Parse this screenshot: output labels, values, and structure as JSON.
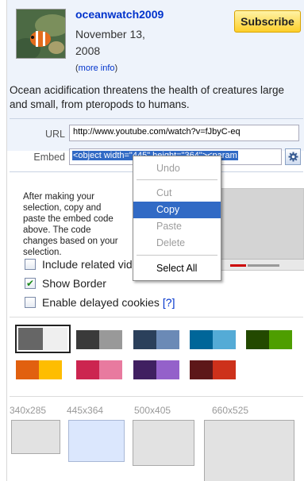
{
  "channel": {
    "name": "oceanwatch2009",
    "date_line1": "November 13,",
    "date_line2": "2008",
    "more_open": "(",
    "more_link": "more info",
    "more_close": ")"
  },
  "subscribe_label": "Subscribe",
  "description": "Ocean acidification threatens the health of creatures large and small, from pteropods to humans.",
  "url_label": "URL",
  "url_value": "http://www.youtube.com/watch?v=fJbyC-eq",
  "embed_label": "Embed",
  "embed_value": "<object width=\"445\" height=\"364\"><param",
  "instructions": "After making your selection, copy and paste the embed code above. The code changes based on your selection.",
  "options": [
    {
      "label": "Include related videos",
      "checked": false
    },
    {
      "label": "Show Border",
      "checked": true
    },
    {
      "label": "Enable delayed cookies",
      "checked": false,
      "help": "[?]"
    }
  ],
  "check_glyph": "✔",
  "color_swatches": [
    {
      "a": "#666666",
      "b": "#efefef",
      "selected": true
    },
    {
      "a": "#3a3a3a",
      "b": "#999999"
    },
    {
      "a": "#2b405b",
      "b": "#6b8ab6"
    },
    {
      "a": "#006699",
      "b": "#54abd6"
    },
    {
      "a": "#234900",
      "b": "#4e9e00"
    },
    {
      "a": "#e1600f",
      "b": "#febd01"
    },
    {
      "a": "#cc2550",
      "b": "#e87a9f"
    },
    {
      "a": "#402061",
      "b": "#9461ca"
    },
    {
      "a": "#5d1719",
      "b": "#cd311b"
    }
  ],
  "sizes": [
    {
      "label": "340x285"
    },
    {
      "label": "445x364",
      "selected": true
    },
    {
      "label": "500x405"
    },
    {
      "label": "660x525"
    }
  ],
  "context_menu": {
    "undo": "Undo",
    "cut": "Cut",
    "copy": "Copy",
    "paste": "Paste",
    "delete": "Delete",
    "select_all": "Select All"
  }
}
